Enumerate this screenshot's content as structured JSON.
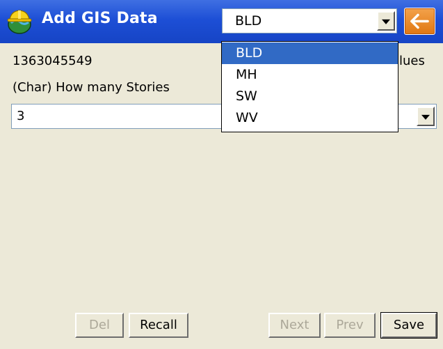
{
  "window": {
    "title": "Add GIS Data"
  },
  "layer_select": {
    "selected": "BLD",
    "options": [
      "BLD",
      "MH",
      "SW",
      "WV"
    ],
    "highlighted_index": 0
  },
  "feature": {
    "id": "1363045549",
    "values_label": "lues"
  },
  "attribute": {
    "label": "(Char) How many Stories",
    "value": "3"
  },
  "buttons": {
    "del": "Del",
    "recall": "Recall",
    "next": "Next",
    "prev": "Prev",
    "save": "Save"
  },
  "icons": {
    "app": "hard-hat-globe-icon",
    "back": "back-arrow-icon",
    "dropdown": "chevron-down-icon"
  },
  "colors": {
    "titlebar": "#1d4fd6",
    "back_button": "#e07712",
    "selection": "#316ac5",
    "background": "#ece9d8",
    "disabled_text": "#aca899"
  }
}
